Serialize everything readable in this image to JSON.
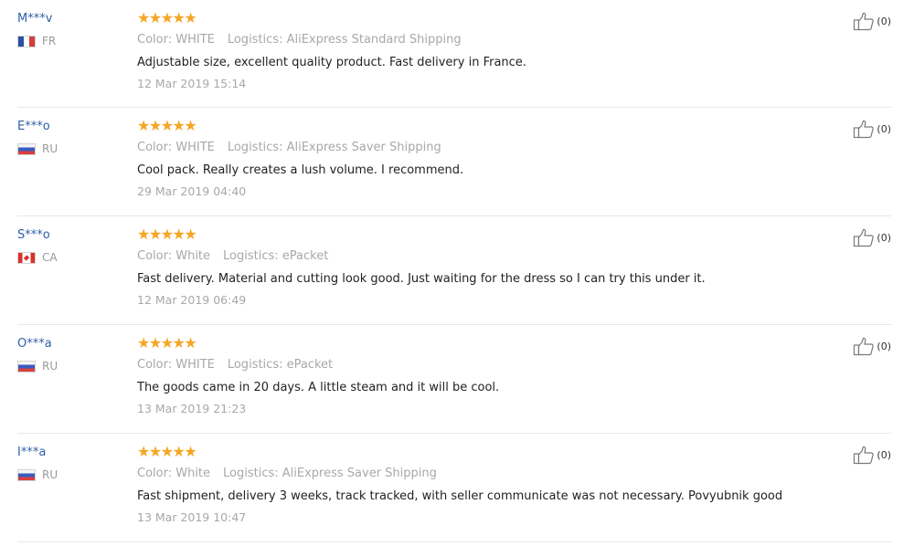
{
  "reviews": [
    {
      "user": "M***v",
      "flag": "fr",
      "country": "FR",
      "rating": 5,
      "color": "Color: WHITE",
      "logistics": "Logistics: AliExpress Standard Shipping",
      "text": "Adjustable size, excellent quality product. Fast delivery in France.",
      "date": "12 Mar 2019 15:14",
      "helpful": "(0)"
    },
    {
      "user": "E***o",
      "flag": "ru",
      "country": "RU",
      "rating": 5,
      "color": "Color: WHITE",
      "logistics": "Logistics: AliExpress Saver Shipping",
      "text": "Cool pack. Really creates a lush volume. I recommend.",
      "date": "29 Mar 2019 04:40",
      "helpful": "(0)"
    },
    {
      "user": "S***o",
      "flag": "ca",
      "country": "CA",
      "rating": 5,
      "color": "Color: White",
      "logistics": "Logistics: ePacket",
      "text": "Fast delivery. Material and cutting look good. Just waiting for the dress so I can try this under it.",
      "date": "12 Mar 2019 06:49",
      "helpful": "(0)"
    },
    {
      "user": "O***a",
      "flag": "ru",
      "country": "RU",
      "rating": 5,
      "color": "Color: WHITE",
      "logistics": "Logistics: ePacket",
      "text": "The goods came in 20 days. A little steam and it will be cool.",
      "date": "13 Mar 2019 21:23",
      "helpful": "(0)"
    },
    {
      "user": "I***a",
      "flag": "ru",
      "country": "RU",
      "rating": 5,
      "color": "Color: White",
      "logistics": "Logistics: AliExpress Saver Shipping",
      "text": "Fast shipment, delivery 3 weeks, track tracked, with seller communicate was not necessary. Povyubnik good",
      "date": "13 Mar 2019 10:47",
      "helpful": "(0)"
    }
  ],
  "icons": {
    "star": "star-icon",
    "thumb": "thumbs-up-icon"
  },
  "colors": {
    "username": "#2f5fa8",
    "star": "#f5a623",
    "muted": "#a8a8a8",
    "text": "#222222"
  }
}
